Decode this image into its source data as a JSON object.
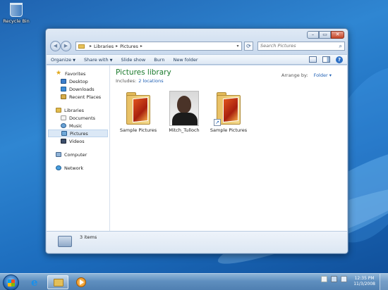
{
  "desktop": {
    "recycle_bin_label": "Recycle Bin"
  },
  "window": {
    "caption_buttons": {
      "minimize": "–",
      "maximize": "▭",
      "close": "✕"
    },
    "address": {
      "root": "Libraries",
      "current": "Pictures"
    },
    "search_placeholder": "Search Pictures",
    "toolbar": {
      "organize": "Organize",
      "share_with": "Share with",
      "slide_show": "Slide show",
      "burn": "Burn",
      "new_folder": "New folder"
    },
    "nav": {
      "favorites": "Favorites",
      "desktop": "Desktop",
      "downloads": "Downloads",
      "recent_places": "Recent Places",
      "libraries": "Libraries",
      "documents": "Documents",
      "music": "Music",
      "pictures": "Pictures",
      "videos": "Videos",
      "computer": "Computer",
      "network": "Network"
    },
    "library": {
      "title": "Pictures library",
      "includes_label": "Includes:",
      "includes_link": "2 locations",
      "arrange_label": "Arrange by:",
      "arrange_value": "Folder"
    },
    "items": [
      {
        "label": "Sample Pictures",
        "kind": "folder"
      },
      {
        "label": "Mitch_Tulloch",
        "kind": "photo"
      },
      {
        "label": "Sample Pictures",
        "kind": "folder-shortcut"
      }
    ],
    "details": {
      "count_text": "3 items"
    }
  },
  "taskbar": {
    "clock_time": "12:35 PM",
    "clock_date": "11/3/2008"
  },
  "colors": {
    "desktop": "#1f63b0",
    "library_title": "#1a7a2c",
    "link": "#1e5fb4"
  }
}
